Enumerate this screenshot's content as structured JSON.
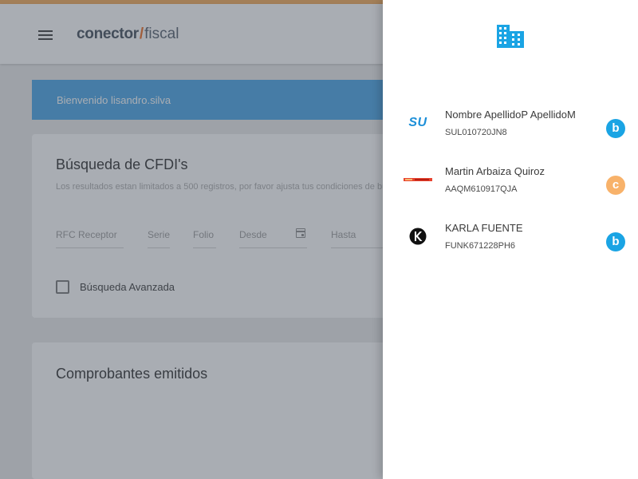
{
  "app": {
    "logo": {
      "strong": "conector",
      "slash": "/",
      "light": "fiscal"
    },
    "welcome": "Bienvenido lisandro.silva",
    "search": {
      "title": "Búsqueda de CFDI's",
      "note": "Los resultados estan limitados a 500 registros, por favor ajusta tus condiciones de búsqueda",
      "fields": {
        "rfc_receptor": "RFC Receptor",
        "serie": "Serie",
        "folio": "Folio",
        "desde": "Desde",
        "hasta": "Hasta"
      },
      "advanced_label": "Búsqueda Avanzada",
      "advanced_checked": false
    },
    "comprobantes": {
      "title": "Comprobantes emitidos"
    }
  },
  "drawer": {
    "header_icon": "building-icon",
    "companies": [
      {
        "name": "Nombre ApellidoP ApellidoM",
        "rfc": "SUL010720JN8",
        "logo_text": "SU",
        "badge": "b",
        "badge_color": "#1aa4e4"
      },
      {
        "name": "Martin Arbaiza Quiroz",
        "rfc": "AAQM610917QJA",
        "logo_text": "",
        "badge": "c",
        "badge_color": "#f8b26a"
      },
      {
        "name": "KARLA FUENTE",
        "rfc": "FUNK671228PH6",
        "logo_text": "",
        "badge": "b",
        "badge_color": "#1aa4e4"
      }
    ]
  },
  "colors": {
    "accent_orange": "#f6b56d",
    "welcome_blue": "#5fb1ea",
    "icon_blue": "#1aa4e4"
  }
}
